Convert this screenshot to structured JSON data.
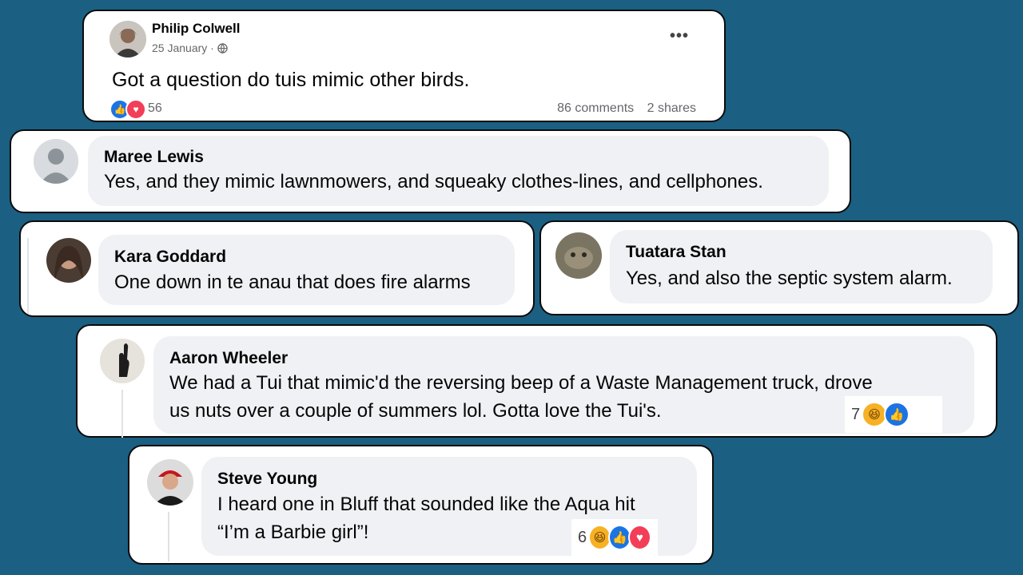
{
  "post": {
    "author": "Philip Colwell",
    "date": "25 January",
    "audience_icon": "globe-icon",
    "more_icon": "more-options-icon",
    "text": "Got a question do tuis mimic other birds.",
    "reaction_count": "56",
    "comments": "86 comments",
    "shares": "2 shares"
  },
  "comments": [
    {
      "name": "Maree Lewis",
      "text": "Yes, and they mimic lawnmowers, and squeaky clothes-lines, and cellphones."
    },
    {
      "name": "Kara Goddard",
      "text": "One down in te anau that does fire alarms"
    },
    {
      "name": "Tuatara Stan",
      "text": "Yes, and also the septic system alarm."
    },
    {
      "name": "Aaron Wheeler",
      "text_line1": "We had a Tui that mimic'd the reversing beep of a Waste Management truck, drove",
      "text_line2": "us nuts over a couple of summers lol. Gotta love the Tui's.",
      "reaction_count": "7"
    },
    {
      "name": "Steve Young",
      "text_line1": "I heard one in Bluff that sounded like the Aqua hit",
      "text_line2": "“I’m a Barbie girl”!",
      "reaction_count": "6"
    }
  ],
  "colors": {
    "background": "#1b5f82",
    "like": "#1b74e4",
    "love": "#f33e58",
    "haha": "#f7b125",
    "bubble": "#eff1f4"
  }
}
